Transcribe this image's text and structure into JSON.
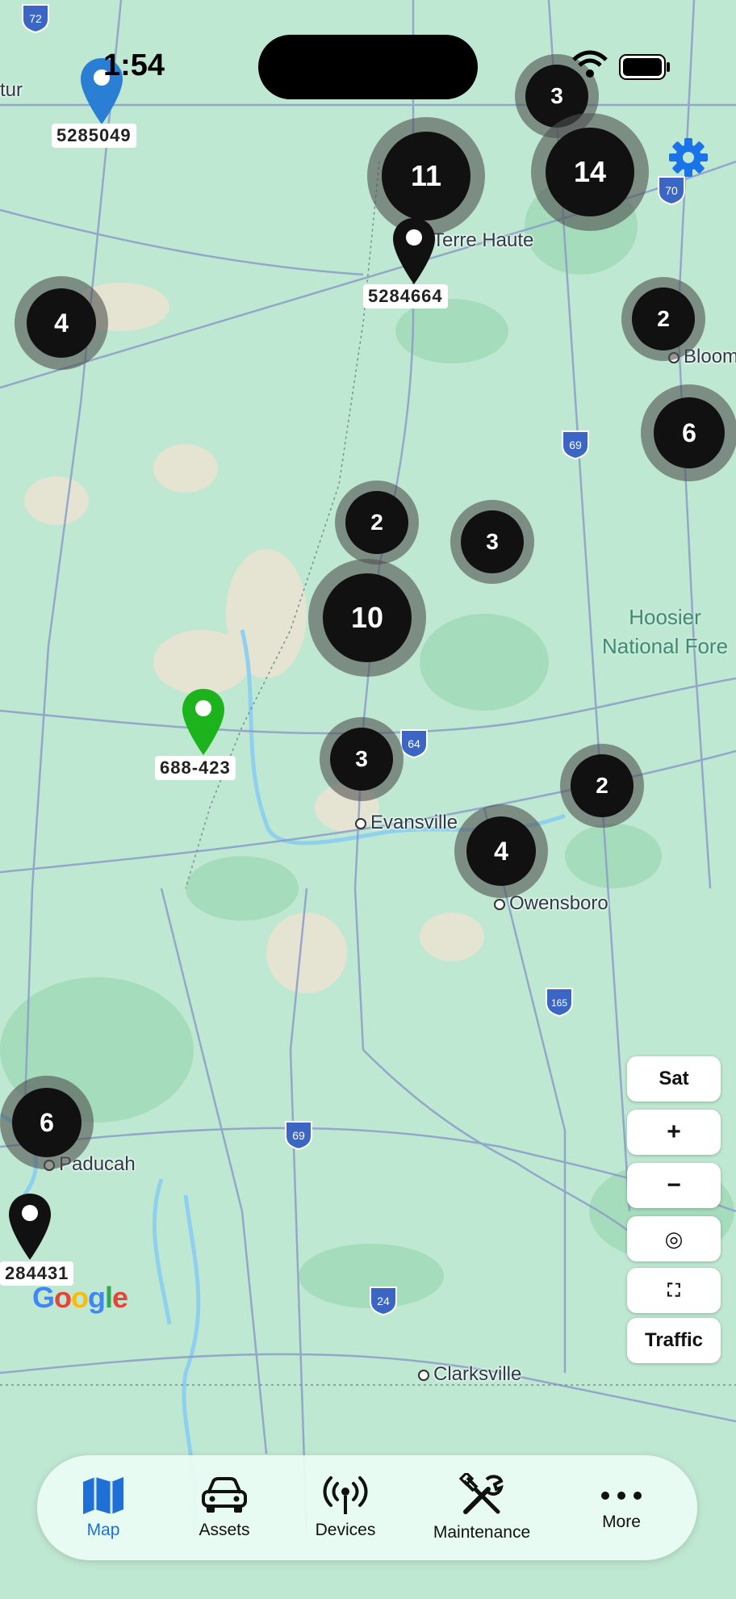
{
  "status_bar": {
    "time": "1:54"
  },
  "places": [
    {
      "name": "Evansville"
    },
    {
      "name": "Owensboro"
    },
    {
      "name": "Paducah"
    },
    {
      "name": "Clarksville"
    },
    {
      "name": "Terre Haute"
    },
    {
      "name": "Bloom"
    },
    {
      "name": "tur"
    }
  ],
  "forest_label": [
    "Hoosier",
    "National Fore"
  ],
  "road_shields": [
    "72",
    "70",
    "69",
    "64",
    "165",
    "69",
    "24"
  ],
  "clusters": [
    {
      "count": "3"
    },
    {
      "count": "11"
    },
    {
      "count": "14"
    },
    {
      "count": "4"
    },
    {
      "count": "2"
    },
    {
      "count": "6"
    },
    {
      "count": "2"
    },
    {
      "count": "3"
    },
    {
      "count": "10"
    },
    {
      "count": "3"
    },
    {
      "count": "2"
    },
    {
      "count": "4"
    },
    {
      "count": "6"
    }
  ],
  "pins": [
    {
      "label": "5285049",
      "color": "#2a7fd4"
    },
    {
      "label": "5284664",
      "color": "#111111"
    },
    {
      "label": "688-423",
      "color": "#1db31d"
    },
    {
      "label": "284431",
      "color": "#111111"
    }
  ],
  "map_controls": {
    "satellite": "Sat",
    "zoom_in": "+",
    "zoom_out": "−",
    "locate": "◎",
    "fullscreen": "⛶",
    "traffic": "Traffic"
  },
  "attribution": "Google",
  "tabs": [
    {
      "label": "Map",
      "icon": "map-icon",
      "active": true
    },
    {
      "label": "Assets",
      "icon": "car-icon",
      "active": false
    },
    {
      "label": "Devices",
      "icon": "antenna-icon",
      "active": false
    },
    {
      "label": "Maintenance",
      "icon": "tools-icon",
      "active": false
    },
    {
      "label": "More",
      "icon": "ellipsis-icon",
      "active": false
    }
  ],
  "colors": {
    "accent": "#1f6fd6",
    "map_land": "#bfe8d2",
    "cluster": "#111111",
    "settings_icon": "#1a73e8"
  }
}
